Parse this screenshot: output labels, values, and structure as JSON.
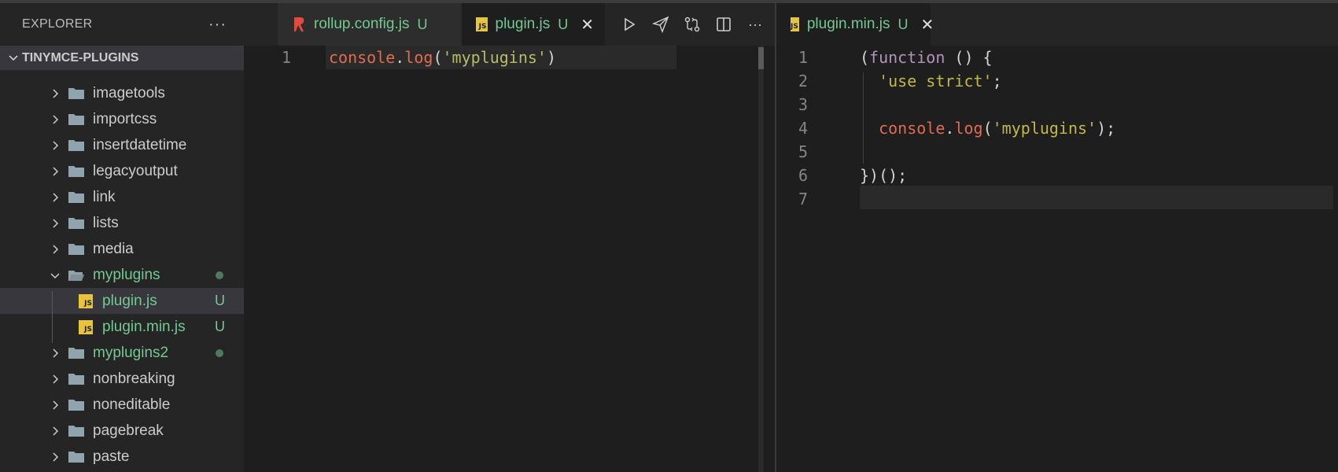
{
  "sidebar": {
    "title": "EXPLORER",
    "more": "···",
    "section": "TINYMCE-PLUGINS",
    "items": [
      {
        "label": "imagetools",
        "type": "folder"
      },
      {
        "label": "importcss",
        "type": "folder"
      },
      {
        "label": "insertdatetime",
        "type": "folder"
      },
      {
        "label": "legacyoutput",
        "type": "folder"
      },
      {
        "label": "link",
        "type": "folder"
      },
      {
        "label": "lists",
        "type": "folder"
      },
      {
        "label": "media",
        "type": "folder"
      },
      {
        "label": "myplugins",
        "type": "folder-open",
        "status": "modified-dot"
      },
      {
        "label": "plugin.js",
        "type": "js",
        "status": "U"
      },
      {
        "label": "plugin.min.js",
        "type": "js",
        "status": "U"
      },
      {
        "label": "myplugins2",
        "type": "folder",
        "status": "modified-dot"
      },
      {
        "label": "nonbreaking",
        "type": "folder"
      },
      {
        "label": "noneditable",
        "type": "folder"
      },
      {
        "label": "pagebreak",
        "type": "folder"
      },
      {
        "label": "paste",
        "type": "folder"
      }
    ]
  },
  "group1": {
    "tabs": [
      {
        "label": "rollup.config.js",
        "badge": "U",
        "icon": "rollup-icon"
      },
      {
        "label": "plugin.js",
        "badge": "U",
        "icon": "js-icon",
        "close": "✕"
      }
    ],
    "actions": [
      "run-icon",
      "send-icon",
      "compare-changes-icon",
      "split-editor-icon",
      "more-icon"
    ],
    "lines": [
      {
        "n": "1",
        "parts": [
          [
            "console",
            "red"
          ],
          [
            ".",
            "dim"
          ],
          [
            "log",
            "red"
          ],
          [
            "(",
            "dim"
          ],
          [
            "'myplugins'",
            "str"
          ],
          [
            ")",
            "dim"
          ]
        ]
      }
    ]
  },
  "group2": {
    "tabs": [
      {
        "label": "plugin.min.js",
        "badge": "U",
        "icon": "js-icon",
        "close": "✕"
      }
    ],
    "lines": [
      {
        "n": "1",
        "parts": [
          [
            "(",
            "dim"
          ],
          [
            "function",
            "kw"
          ],
          [
            " () {",
            "dim"
          ]
        ]
      },
      {
        "n": "2",
        "parts": [
          [
            "  ",
            "dim"
          ],
          [
            "'use strict'",
            "str2"
          ],
          [
            ";",
            "dim"
          ]
        ]
      },
      {
        "n": "3",
        "parts": []
      },
      {
        "n": "4",
        "parts": [
          [
            "  ",
            "dim"
          ],
          [
            "console",
            "red"
          ],
          [
            ".",
            "dim"
          ],
          [
            "log",
            "red"
          ],
          [
            "(",
            "dim"
          ],
          [
            "'myplugins'",
            "str2"
          ],
          [
            ");",
            "dim"
          ]
        ]
      },
      {
        "n": "5",
        "parts": []
      },
      {
        "n": "6",
        "parts": [
          [
            "})();",
            "dim"
          ]
        ]
      },
      {
        "n": "7",
        "parts": []
      }
    ]
  },
  "colors": {
    "untracked": "#73c991",
    "js_badge": "#e8c33c",
    "rollup": "#e04a3f"
  }
}
